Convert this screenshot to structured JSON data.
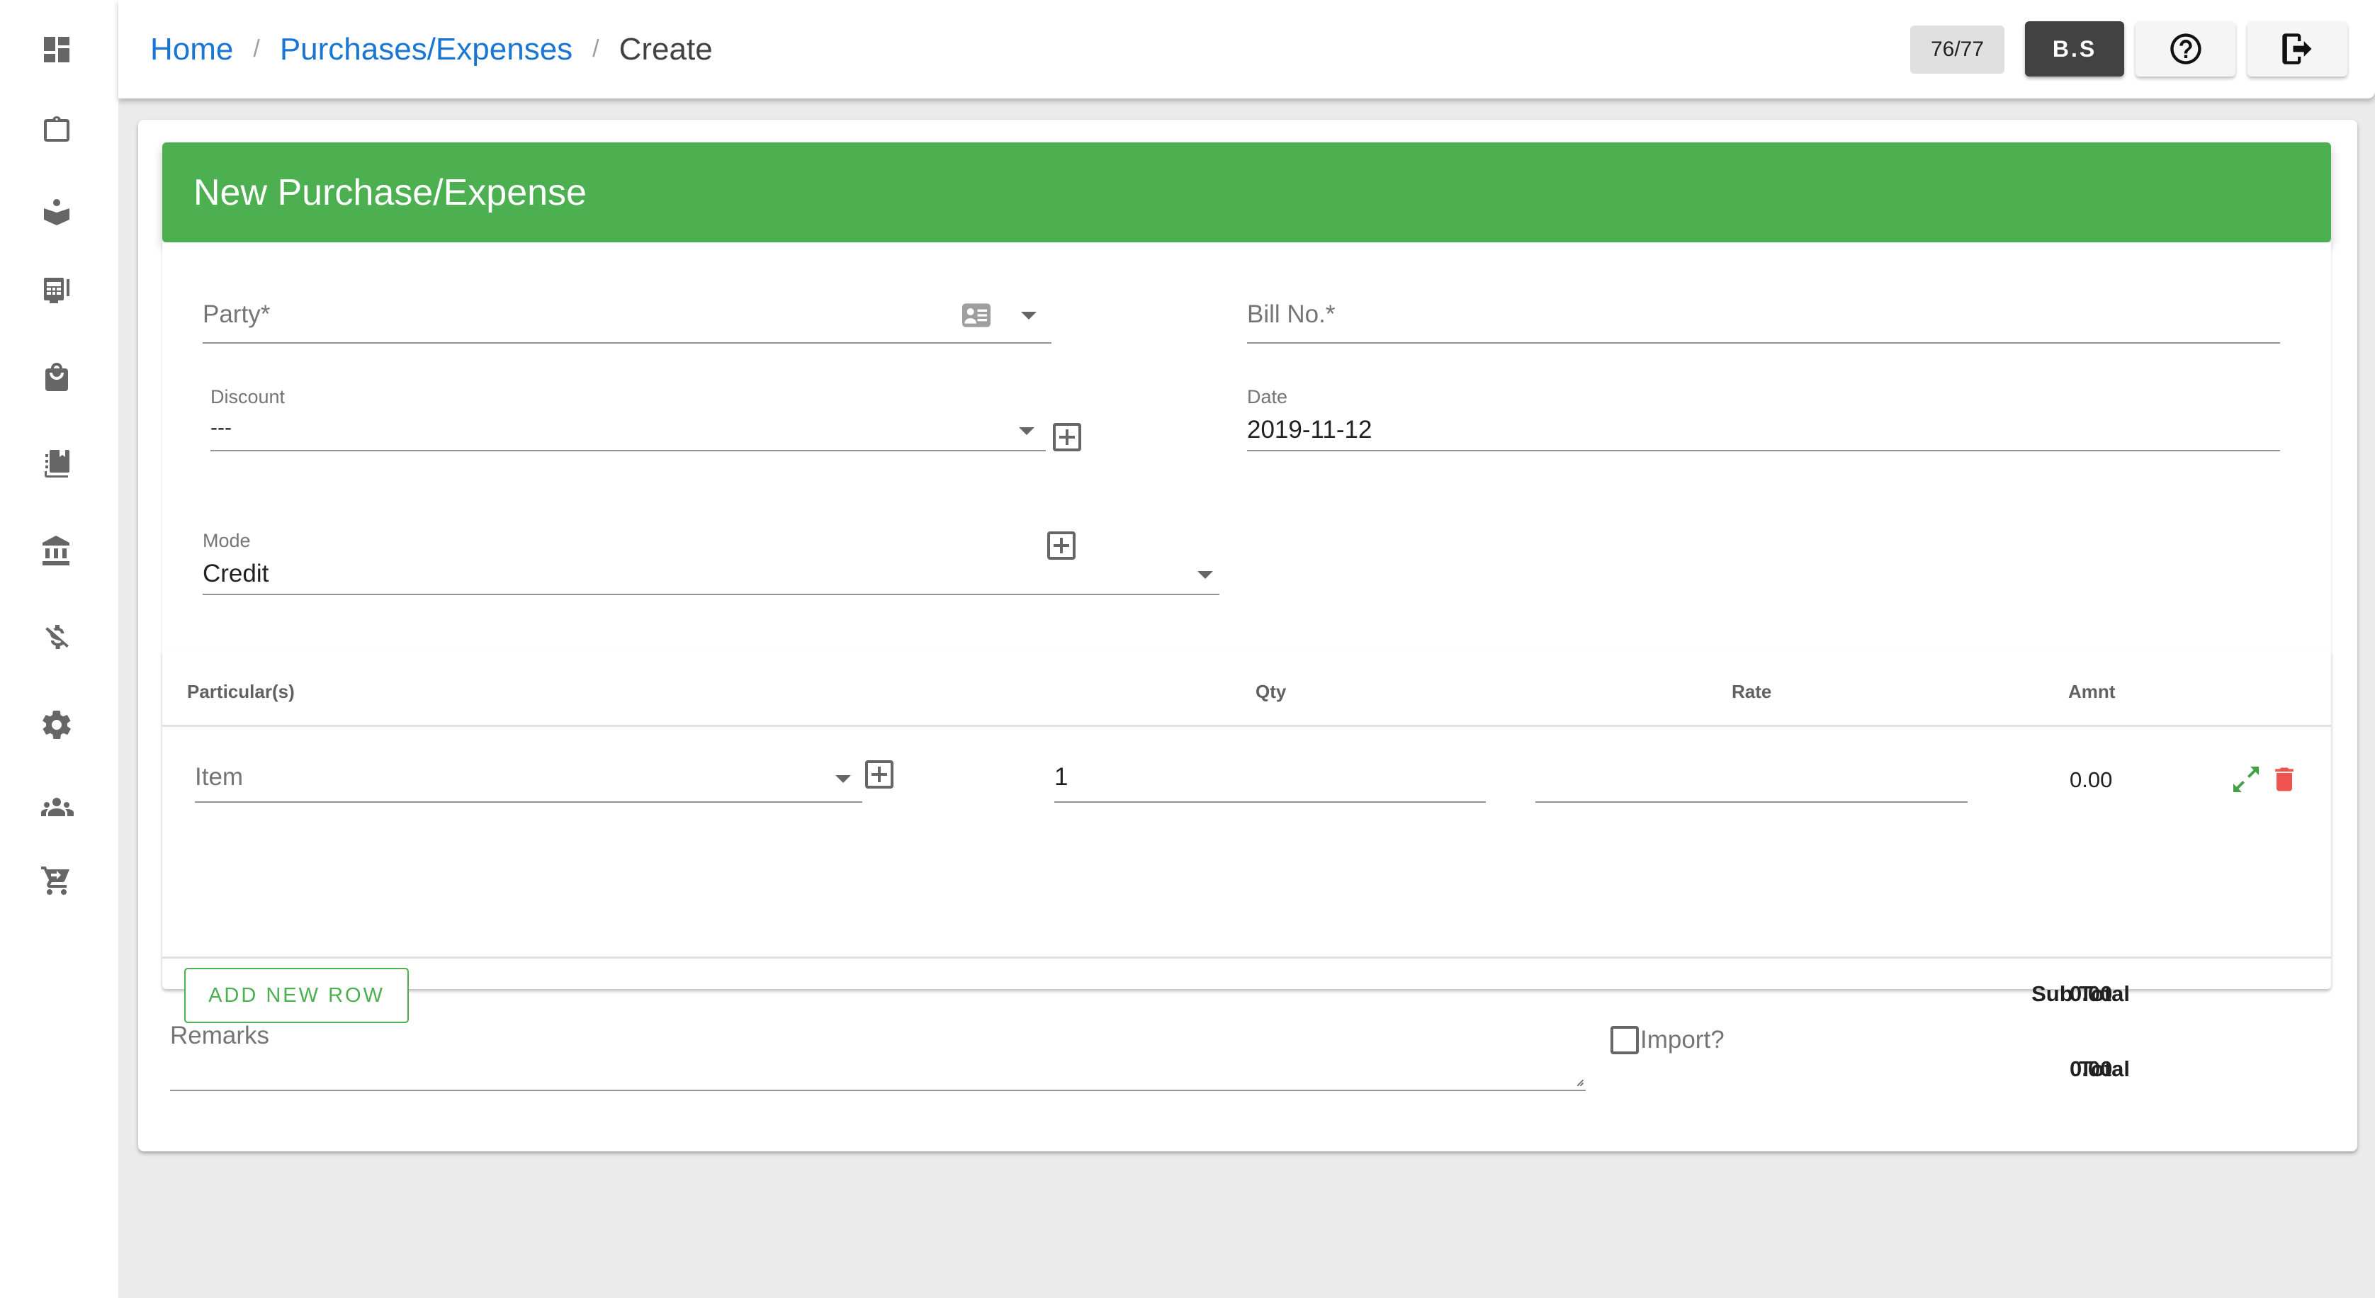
{
  "sidebar": {
    "items": [
      {
        "name": "dashboard",
        "icon": "dashboard-icon"
      },
      {
        "name": "clipboard",
        "icon": "clipboard-icon"
      },
      {
        "name": "reader",
        "icon": "book-reader-icon"
      },
      {
        "name": "pos-terminal",
        "icon": "pos-terminal-icon"
      },
      {
        "name": "shopping-bag",
        "icon": "shopping-bag-icon"
      },
      {
        "name": "inventory-book",
        "icon": "inventory-book-icon"
      },
      {
        "name": "bank",
        "icon": "bank-icon"
      },
      {
        "name": "no-money",
        "icon": "money-off-icon"
      },
      {
        "name": "settings",
        "icon": "gear-icon"
      },
      {
        "name": "people",
        "icon": "people-icon"
      },
      {
        "name": "cart",
        "icon": "cart-arrow-icon"
      }
    ]
  },
  "header": {
    "breadcrumb": {
      "home": "Home",
      "section": "Purchases/Expenses",
      "current": "Create",
      "separator": "/"
    },
    "counter": "76/77",
    "calendar_toggle": "B.S",
    "help_icon": "help-circle-icon",
    "logout_icon": "logout-icon"
  },
  "form": {
    "title": "New Purchase/Expense",
    "party": {
      "placeholder": "Party*",
      "value": ""
    },
    "bill_no": {
      "placeholder": "Bill No.*",
      "value": ""
    },
    "discount": {
      "label": "Discount",
      "value": "---"
    },
    "date": {
      "label": "Date",
      "value": "2019-11-12"
    },
    "mode": {
      "label": "Mode",
      "value": "Credit"
    }
  },
  "table": {
    "columns": [
      "Particular(s)",
      "Qty",
      "Rate",
      "Amnt"
    ],
    "rows": [
      {
        "item_placeholder": "Item",
        "qty": "1",
        "rate": "",
        "amount": "0.00"
      }
    ],
    "add_row_label": "ADD NEW ROW",
    "sub_total_label": "Sub Total",
    "sub_total": "0.00",
    "total_label": "Total",
    "total": "0.00"
  },
  "footer": {
    "remarks_placeholder": "Remarks",
    "import_label": "Import?",
    "import_checked": false
  },
  "colors": {
    "primary": "#4caf50",
    "link": "#1976d2",
    "danger": "#ef5350",
    "dark_button": "#424242"
  }
}
